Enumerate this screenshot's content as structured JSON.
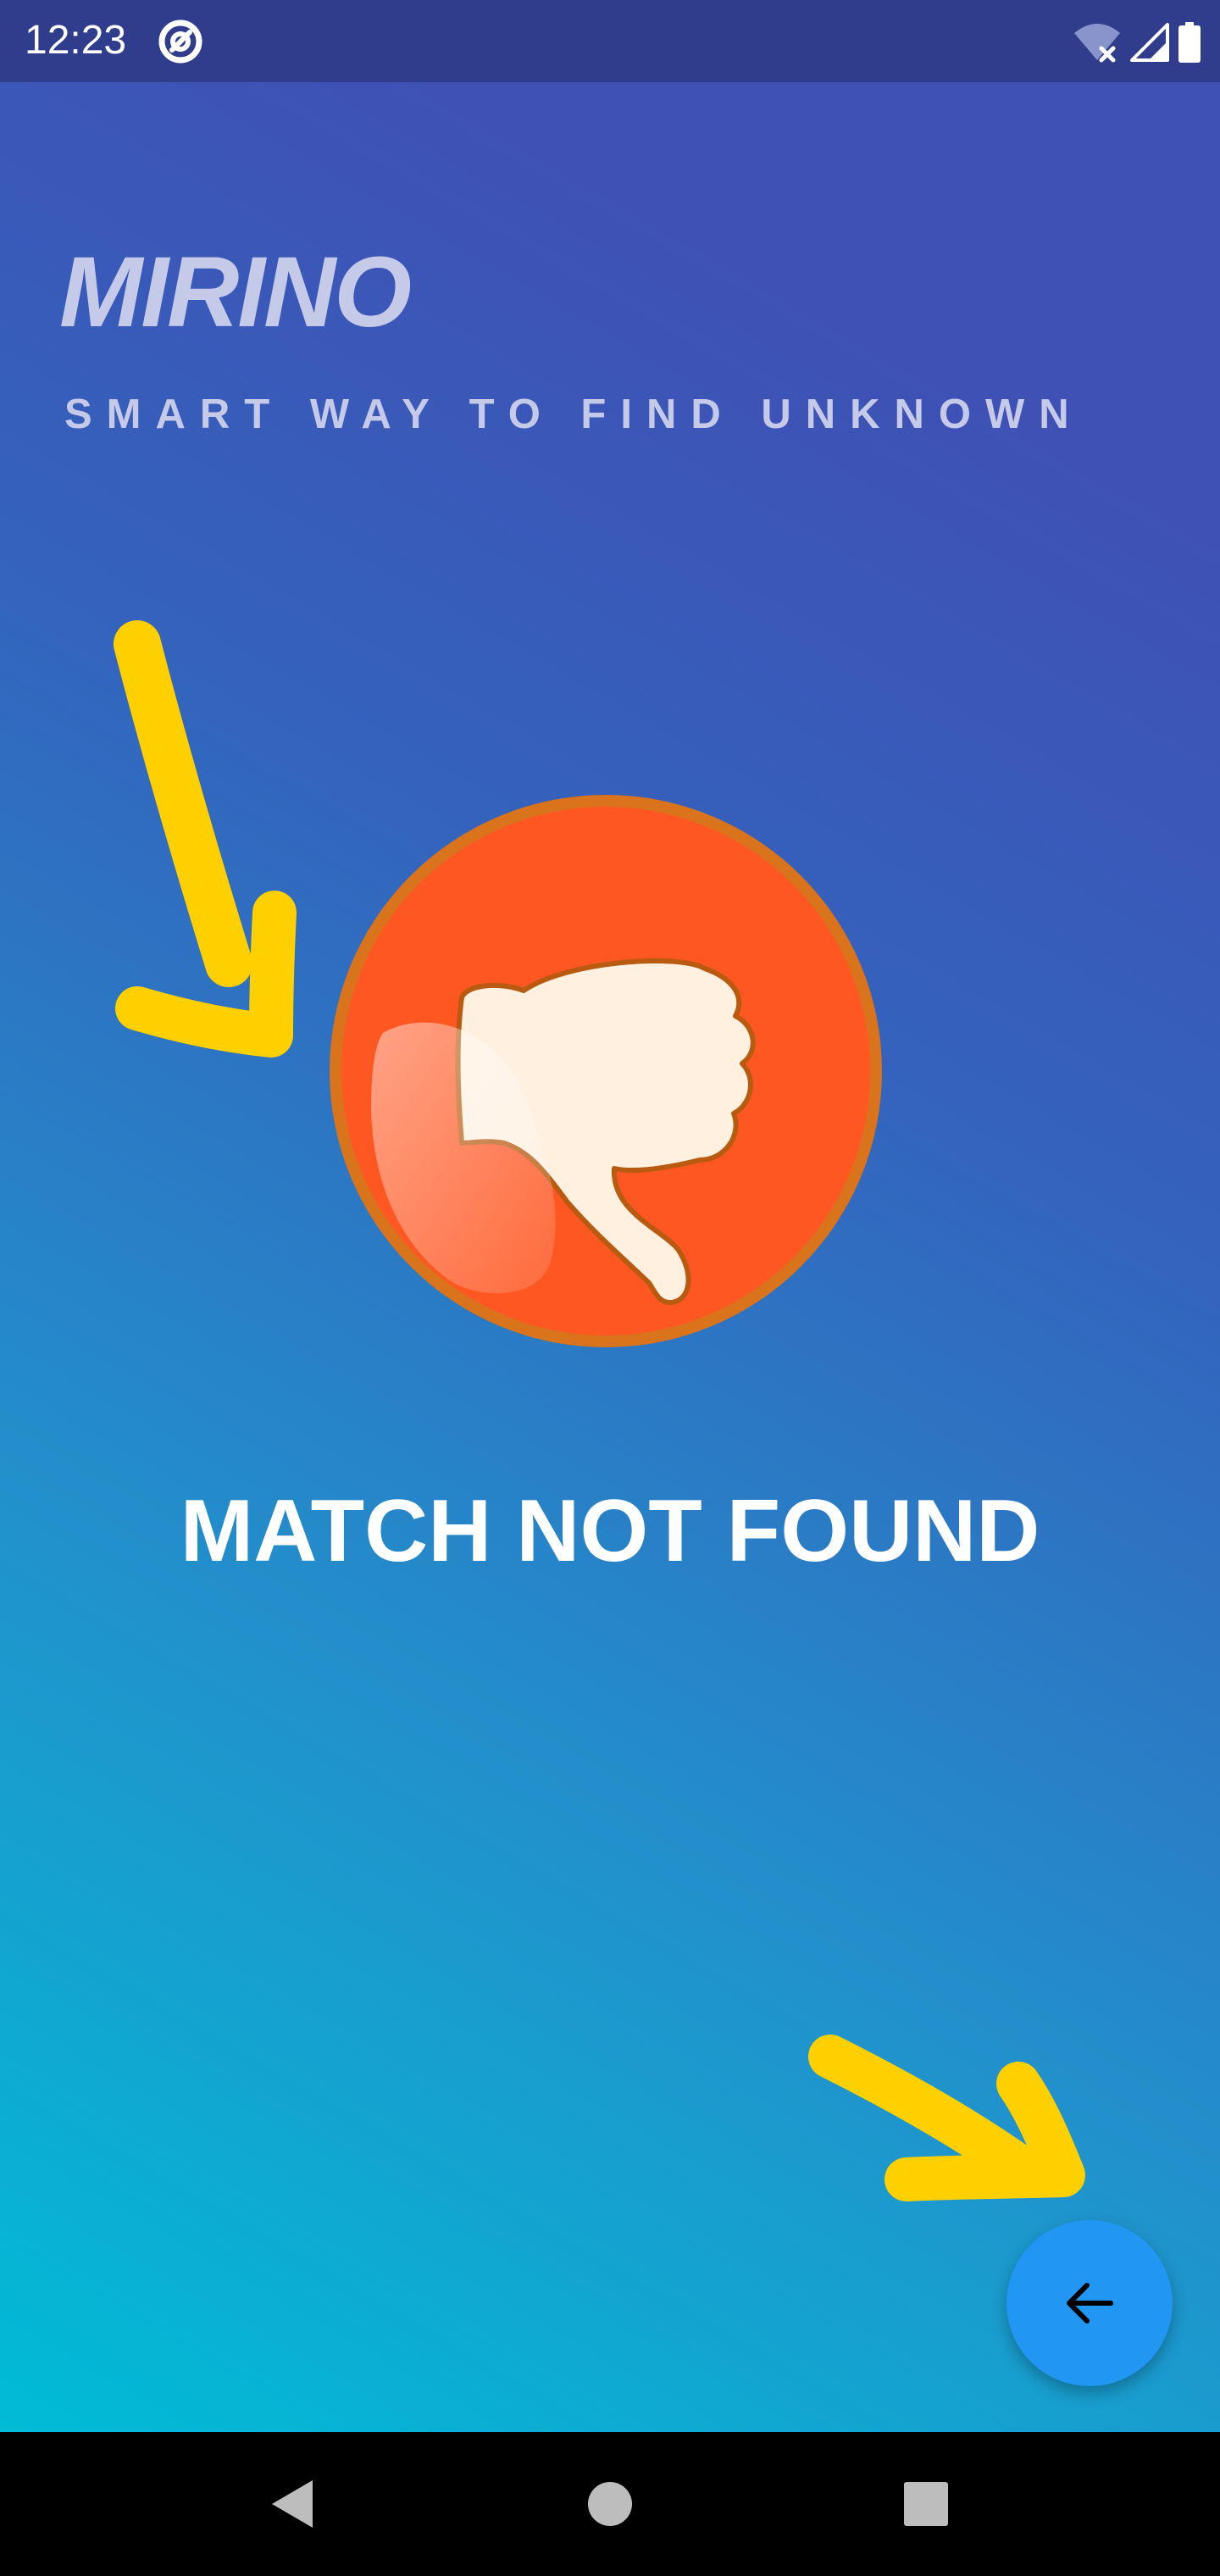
{
  "status_bar": {
    "time": "12:23",
    "icons": [
      "app-notification-icon",
      "wifi-off-icon",
      "cellular-signal-icon",
      "battery-icon"
    ]
  },
  "app": {
    "title": "MIRINO",
    "subtitle": "SMART WAY TO FIND UNKNOWN"
  },
  "result": {
    "icon": "thumbs-down-icon",
    "message": "MATCH NOT FOUND"
  },
  "fab": {
    "icon": "arrow-back-icon"
  },
  "navigation_bar": {
    "buttons": [
      "back-triangle-icon",
      "home-circle-icon",
      "recents-square-icon"
    ]
  },
  "colors": {
    "status_bar": "#303d8c",
    "gradient_top": "#3f51b5",
    "gradient_bottom": "#00bcd6",
    "title_text": "#c5cae9",
    "fab": "#2196f3",
    "badge": "#ff5722",
    "badge_ring": "#d9731c",
    "thumb": "#fff0e0",
    "annotation_arrow": "#ffd000"
  }
}
